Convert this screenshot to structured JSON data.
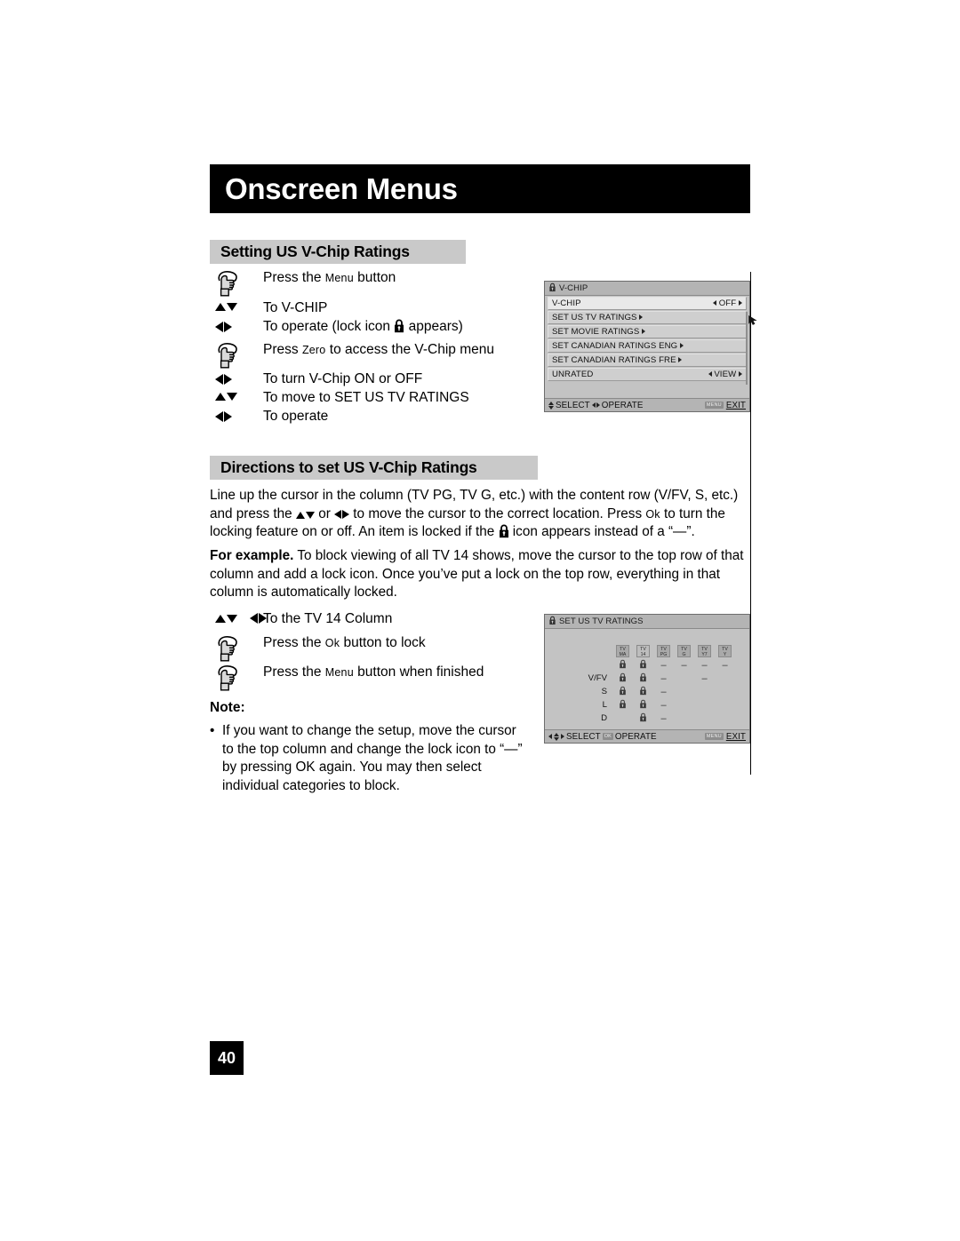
{
  "banner": {
    "title": "Onscreen Menus"
  },
  "sections": {
    "setting_heading": "Setting US V-Chip Ratings",
    "directions_heading": "Directions to set US V-Chip Ratings"
  },
  "steps_top": [
    {
      "icon": "hand-press-icon",
      "text_pre": "Press the ",
      "smallcap": "Menu",
      "text_post": " button"
    },
    {
      "icon": "up-down-arrows-icon",
      "text_pre": "To V-CHIP",
      "smallcap": "",
      "text_post": ""
    },
    {
      "icon": "left-right-arrows-icon",
      "text_pre": "To operate (lock icon ",
      "smallcap": "",
      "text_post": " appears)",
      "has_lock": true
    },
    {
      "icon": "hand-press-icon",
      "text_pre": "Press ",
      "smallcap": "Zero",
      "text_post": " to access the V-Chip menu"
    },
    {
      "icon": "left-right-arrows-icon",
      "text_pre": "To turn V-Chip ON or OFF",
      "smallcap": "",
      "text_post": ""
    },
    {
      "icon": "up-down-arrows-icon",
      "text_pre": "To move to SET US TV RATINGS",
      "smallcap": "",
      "text_post": ""
    },
    {
      "icon": "left-right-arrows-icon",
      "text_pre": "To operate",
      "smallcap": "",
      "text_post": ""
    }
  ],
  "steps_bottom": [
    {
      "icon": "up-down-left-right-arrows-icon",
      "text_pre": "To the TV 14 Column",
      "smallcap": "",
      "text_post": ""
    },
    {
      "icon": "hand-press-icon",
      "text_pre": "Press the ",
      "smallcap": "Ok",
      "text_post": " button to lock"
    },
    {
      "icon": "hand-press-icon",
      "text_pre": "Press the ",
      "smallcap": "Menu",
      "text_post": " button when finished"
    }
  ],
  "paragraphs": {
    "directions_p1_a": "Line up the cursor in the column (TV PG, TV G, etc.) with the content row (V/FV, S, etc.) and press the ",
    "directions_p1_b": " or ",
    "directions_p1_c": " to move the cursor to the correct location. Press ",
    "directions_p1_ok": "Ok",
    "directions_p1_d": " to turn the locking feature on or off. An item is locked if the ",
    "directions_p1_e": " icon appears instead of a “—”.",
    "example_label": "For example.",
    "example_text": " To block viewing of all TV 14 shows, move the cursor to the top row of that column and add a lock icon. Once you’ve put a lock on the top row, everything in that column is automatically locked."
  },
  "note": {
    "title": "Note:",
    "bullet": "•",
    "text": "If you want to change the setup, move the cursor to the top column and change the lock icon to “—” by pressing OK again. You may then select individual categories to block."
  },
  "osd_vchip": {
    "title": "V-CHIP",
    "rows": [
      {
        "label": "V-CHIP",
        "value": "OFF",
        "value_arrows": "both",
        "selected": true
      },
      {
        "label": "SET US TV RATINGS",
        "value": "",
        "value_arrows": "right-inline",
        "selected": false
      },
      {
        "label": "SET MOVIE RATINGS",
        "value": "",
        "value_arrows": "right-inline",
        "selected": false
      },
      {
        "label": "SET CANADIAN RATINGS ENG",
        "value": "",
        "value_arrows": "right-inline",
        "selected": false
      },
      {
        "label": "SET CANADIAN RATINGS FRE",
        "value": "",
        "value_arrows": "right-inline",
        "selected": false
      },
      {
        "label": "UNRATED",
        "value": "VIEW",
        "value_arrows": "both",
        "selected": false
      }
    ],
    "footer": {
      "select": "SELECT",
      "operate": "OPERATE",
      "menu_key": "MENU",
      "exit": "EXIT"
    }
  },
  "osd_ratings": {
    "title": "SET US TV RATINGS",
    "columns": [
      {
        "top": "TV",
        "bottom": "MA"
      },
      {
        "top": "TV",
        "bottom": "14"
      },
      {
        "top": "TV",
        "bottom": "PG"
      },
      {
        "top": "TV",
        "bottom": "G"
      },
      {
        "top": "TV",
        "bottom": "Y7"
      },
      {
        "top": "TV",
        "bottom": "Y"
      }
    ],
    "rows": [
      {
        "label": "",
        "cells": [
          "lock",
          "lock",
          "dash",
          "dash",
          "dash",
          "dash"
        ]
      },
      {
        "label": "V/FV",
        "cells": [
          "lock",
          "lock",
          "dash",
          "",
          "dash",
          ""
        ]
      },
      {
        "label": "S",
        "cells": [
          "lock",
          "lock",
          "dash",
          "",
          "",
          ""
        ]
      },
      {
        "label": "L",
        "cells": [
          "lock",
          "lock",
          "dash",
          "",
          "",
          ""
        ]
      },
      {
        "label": "D",
        "cells": [
          "",
          "lock",
          "dash",
          "",
          "",
          ""
        ]
      }
    ],
    "footer": {
      "select": "SELECT",
      "ok_key": "OK",
      "operate": "OPERATE",
      "menu_key": "MENU",
      "exit": "EXIT"
    }
  },
  "page_number": "40",
  "colors": {
    "banner_bg": "#000000",
    "section_heading_bg": "#c9c9c9",
    "osd_bg": "#c3c3c3",
    "osd_title_bg": "#b4b4b4"
  }
}
